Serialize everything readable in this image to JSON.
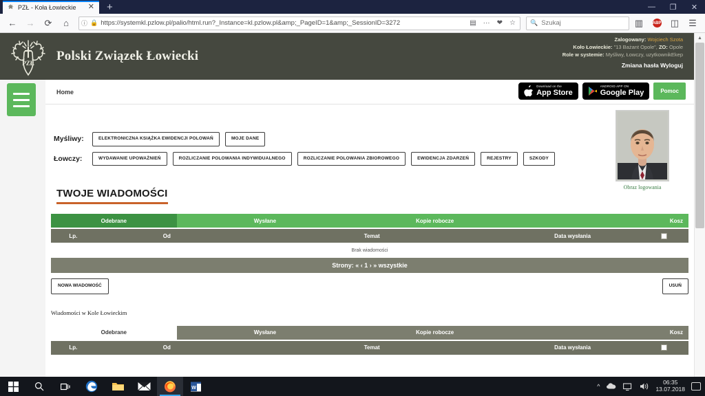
{
  "browser": {
    "tab_title": "PZŁ - Koła Łowieckie",
    "tab_close": "✕",
    "new_tab": "+",
    "url": "https://systemkl.pzlow.pl/palio/html.run?_Instance=kl.pzlow.pl&amp;_PageID=1&amp;_SessionID=3272",
    "url_bold": "pzlow.pl",
    "search_placeholder": "Szukaj",
    "search_value": "",
    "back": "←",
    "forward": "→",
    "reload": "⟳",
    "home": "⌂",
    "reader": "▤",
    "page_actions": "···",
    "pocket": "❤",
    "bookmark": "☆",
    "library": "▥",
    "adblock": "ABP",
    "sidebar": "◫",
    "menu": "☰",
    "minimize": "—",
    "maximize": "❐",
    "close": "✕"
  },
  "header": {
    "site_title": "Polski Związek Łowiecki",
    "logged_label": "Zalogowany:",
    "logged_value": "Wojciech Szota",
    "circle_label": "Koło Łowieckie:",
    "circle_value": "\"13 Bażant Opole\",",
    "zo_label": "ZO:",
    "zo_value": "Opole",
    "roles_label": "Role w systemie:",
    "roles_value": "Myśliwy, Łowczy, uzytkownikEkep",
    "change_password": "Zmiana hasła",
    "logout": "Wyloguj"
  },
  "nav": {
    "burger": "menu-toggle",
    "breadcrumb": "Home",
    "appstore_sub": "Download on the",
    "appstore_big": "App Store",
    "googleplay_sub": "ANDROID APP ON",
    "googleplay_big": "Google Play",
    "help": "Pomoc"
  },
  "roles": [
    {
      "label": "Myśliwy:",
      "buttons": [
        "ELEKTRONICZNA KSIĄŻKA EWIDENCJI POLOWAŃ",
        "MOJE DANE"
      ]
    },
    {
      "label": "Łowczy:",
      "buttons": [
        "WYDAWANIE UPOWAŻNIEŃ",
        "ROZLICZANIE POLOWANIA INDYWIDUALNEGO",
        "ROZLICZANIE POLOWANIA ZBIOROWEGO",
        "EWIDENCJA ZDARZEŃ",
        "REJESTRY",
        "SZKODY"
      ]
    }
  ],
  "photo": {
    "caption": "Obraz logowania"
  },
  "messages": {
    "title": "TWOJE WIADOMOŚCI",
    "tabs": [
      "Odebrane",
      "Wysłane",
      "Kopie robocze",
      "Kosz"
    ],
    "active_tab": "Odebrane",
    "columns": [
      "Lp.",
      "Od",
      "Temat",
      "Data wysłania"
    ],
    "empty": "Brak wiadomości",
    "pager": "Strony: « ‹ 1 › » wszystkie",
    "new_message": "NOWA WIADOMOŚĆ",
    "delete": "USUŃ"
  },
  "club_messages": {
    "title": "Wiadomości w Kole Łowieckim",
    "tabs": [
      "Odebrane",
      "Wysłane",
      "Kopie robocze",
      "Kosz"
    ],
    "active_tab": "Odebrane",
    "columns": [
      "Lp.",
      "Od",
      "Temat",
      "Data wysłania"
    ]
  },
  "taskbar": {
    "start": "start-icon",
    "search": "search-icon",
    "taskview": "task-view-icon",
    "edge": "edge-icon",
    "explorer": "file-explorer-icon",
    "mail": "mail-icon",
    "firefox": "firefox-icon",
    "word": "word-icon",
    "tray_chevron": "^",
    "time": "06:35",
    "date": "13.07.2018"
  },
  "colors": {
    "green": "#5cb85c",
    "green_dark": "#3c9243",
    "olive": "#7c7e6f",
    "header_dark": "#45483f",
    "accent_orange": "#c9622a",
    "gold": "#d9a441"
  }
}
